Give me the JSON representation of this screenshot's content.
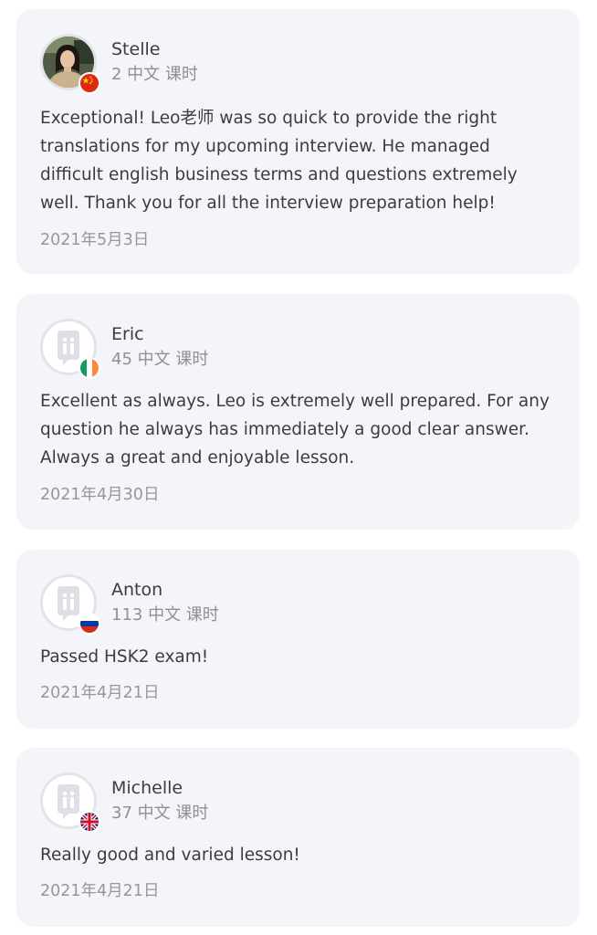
{
  "reviews": [
    {
      "name": "Stelle",
      "lessons": "2 中文 课时",
      "text": "Exceptional! Leo老师 was so quick to provide the right translations for my upcoming interview. He managed difficult english business terms and questions extremely well. Thank you for all the interview preparation help!",
      "date": "2021年5月3日",
      "flag": "china-flag-icon",
      "avatar": "user-photo"
    },
    {
      "name": "Eric",
      "lessons": "45 中文 课时",
      "text": "Excellent as always. Leo is extremely well prepared. For any question he always has immediately a good clear answer. Always a great and enjoyable lesson.",
      "date": "2021年4月30日",
      "flag": "ireland-flag-icon",
      "avatar": "default-avatar-icon"
    },
    {
      "name": "Anton",
      "lessons": "113 中文 课时",
      "text": "Passed HSK2 exam!",
      "date": "2021年4月21日",
      "flag": "russia-flag-icon",
      "avatar": "default-avatar-icon"
    },
    {
      "name": "Michelle",
      "lessons": "37 中文 课时",
      "text": "Really good and varied lesson!",
      "date": "2021年4月21日",
      "flag": "uk-flag-icon",
      "avatar": "default-avatar-icon"
    }
  ],
  "colors": {
    "card_background": "#f4f5f9",
    "text_primary": "#3b3b46",
    "text_secondary": "#8e8f99"
  }
}
